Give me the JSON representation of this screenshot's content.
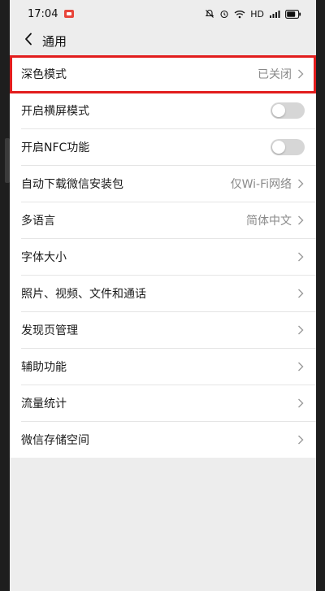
{
  "status_bar": {
    "time": "17:04",
    "network": "HD"
  },
  "header": {
    "title": "通用"
  },
  "settings": {
    "dark_mode": {
      "label": "深色模式",
      "value": "已关闭"
    },
    "landscape": {
      "label": "开启横屏模式",
      "enabled": false
    },
    "nfc": {
      "label": "开启NFC功能",
      "enabled": false
    },
    "auto_download": {
      "label": "自动下载微信安装包",
      "value": "仅Wi-Fi网络"
    },
    "language": {
      "label": "多语言",
      "value": "简体中文"
    },
    "font_size": {
      "label": "字体大小"
    },
    "media": {
      "label": "照片、视频、文件和通话"
    },
    "discover": {
      "label": "发现页管理"
    },
    "accessibility": {
      "label": "辅助功能"
    },
    "traffic": {
      "label": "流量统计"
    },
    "storage": {
      "label": "微信存储空间"
    }
  },
  "icons": [
    "back-arrow-icon",
    "chevron-right-icon",
    "alarm-icon",
    "bell-off-icon",
    "wifi-icon",
    "signal-icon",
    "battery-icon"
  ],
  "colors": {
    "highlight": "#e21d1d",
    "background": "#ededed",
    "toggle_off": "#d6d6d6"
  }
}
